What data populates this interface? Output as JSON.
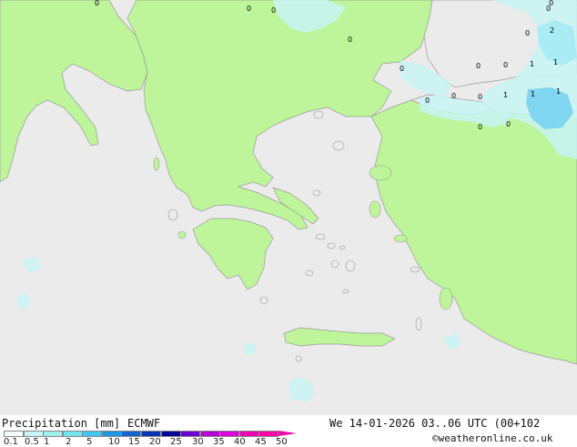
{
  "legend": {
    "title": "Precipitation [mm]",
    "model": "ECMWF",
    "scale_labels": [
      "0.1",
      "0.5",
      "1",
      "2",
      "5",
      "10",
      "15",
      "20",
      "25",
      "30",
      "35",
      "40",
      "45",
      "50"
    ],
    "scale_colors": [
      "#f5fffd",
      "#c8f5f5",
      "#9ef0f0",
      "#6ee6f0",
      "#3cc8f0",
      "#1e96e6",
      "#1464d2",
      "#0a32b4",
      "#000096",
      "#6e00d2",
      "#b400d2",
      "#dc00dc",
      "#f000b4",
      "#ff00aa"
    ]
  },
  "valid_time": "We 14-01-2026 03..06 UTC (00+102",
  "credit": "©weatheronline.co.uk",
  "colors": {
    "sea": "#ebebeb",
    "land": "#bef59a",
    "precip_light": "#c8f5f5",
    "precip_medium": "#a6ebf5",
    "precip_heavy": "#78d2f0",
    "coast": "#999999"
  },
  "point_labels": [
    "0",
    "0",
    "0",
    "0",
    "0",
    "0",
    "0",
    "1",
    "0",
    "0",
    "0",
    "2",
    "1",
    "0",
    "0",
    "1",
    "1",
    "0",
    "0",
    "0",
    "1"
  ]
}
